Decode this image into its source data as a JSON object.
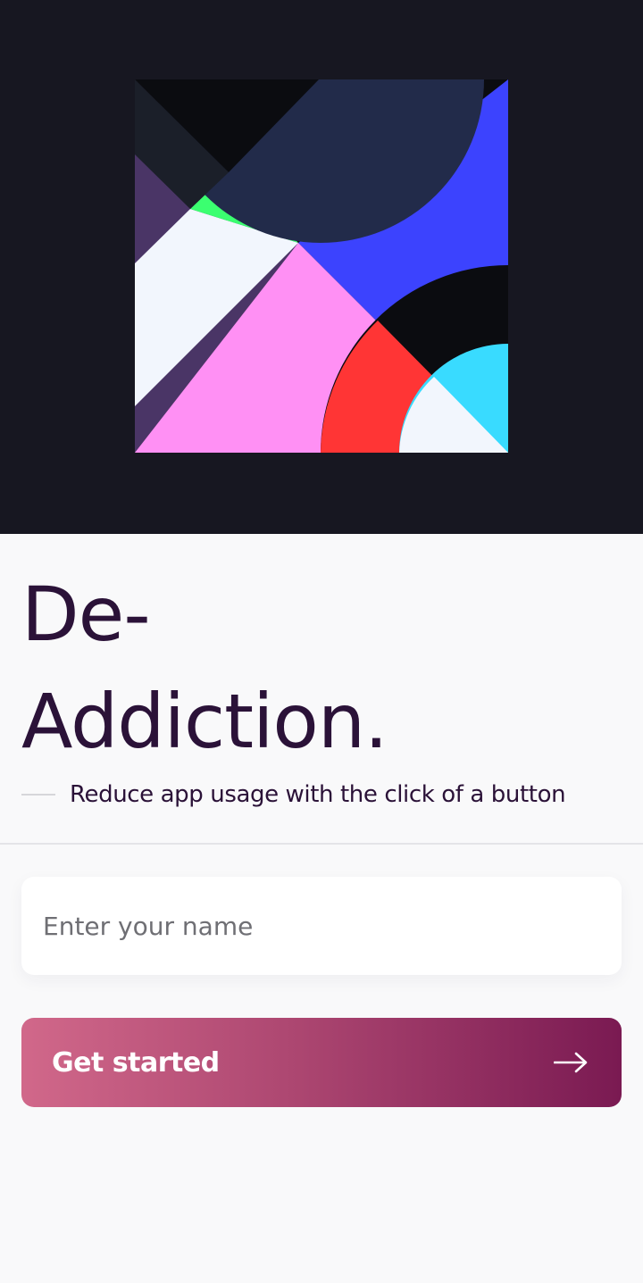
{
  "hero": {
    "artwork_icon": "abstract-geometric-artwork",
    "background": "#171721"
  },
  "title": {
    "line1": "De-",
    "line2": "Addiction."
  },
  "subtitle": "Reduce app usage with the click of a button",
  "name_input": {
    "placeholder": "Enter your name",
    "value": ""
  },
  "start_button": {
    "label": "Get started",
    "icon": "arrow-right-icon"
  },
  "colors": {
    "title_text": "#2b1238",
    "button_gradient_start": "#d1688a",
    "button_gradient_end": "#7a1a52"
  }
}
